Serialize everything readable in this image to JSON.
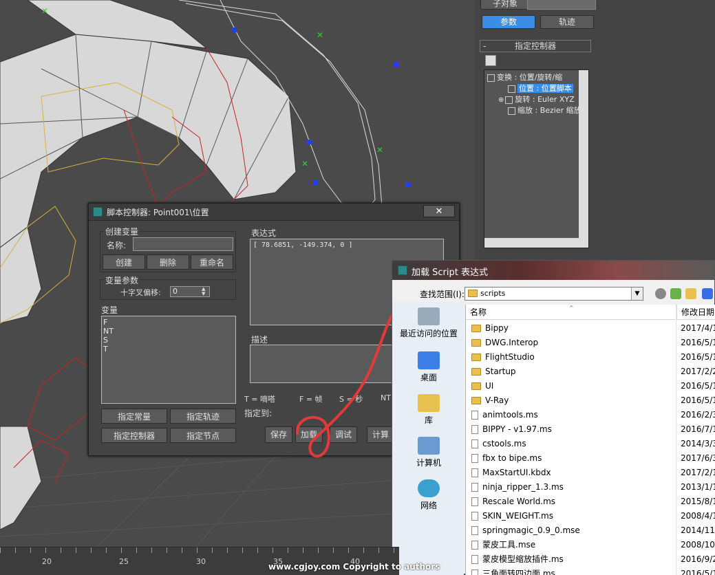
{
  "command_panel": {
    "sub_object_label": "子对象",
    "tabs": [
      {
        "label": "参数",
        "active": true
      },
      {
        "label": "轨迹",
        "active": false
      }
    ],
    "rollout_title": "指定控制器",
    "rollout_toggle": "-",
    "tree": [
      {
        "label": "变换 : 位置/旋转/缩",
        "selected": false
      },
      {
        "label": "位置 : 位置脚本",
        "selected": true
      },
      {
        "label": "旋转 : Euler XYZ",
        "selected": false
      },
      {
        "label": "缩放 : Bezier 缩放",
        "selected": false
      }
    ]
  },
  "script_dialog": {
    "title": "脚本控制器: Point001\\位置",
    "close_label": "✕",
    "create_variable": {
      "group_label": "创建变量",
      "name_label": "名称:",
      "name_value": "",
      "buttons": [
        "创建",
        "删除",
        "重命名"
      ]
    },
    "variable_params": {
      "group_label": "变量参数",
      "offset_label": "十字叉偏移:",
      "offset_value": "0"
    },
    "variables": {
      "label": "变量",
      "items": [
        "F",
        "NT",
        "S",
        "T"
      ]
    },
    "assign_buttons": [
      "指定常量",
      "指定轨迹",
      "指定控制器",
      "指定节点"
    ],
    "expression": {
      "label": "表达式",
      "value": "[ 78.6851, -149.374, 0 ]"
    },
    "description": {
      "label": "描述",
      "value": ""
    },
    "legend": [
      "T = 嘀嗒",
      "F = 帧",
      "S = 秒",
      "NT"
    ],
    "assign_to_label": "指定到:",
    "bottom_buttons": [
      "保存",
      "加载",
      "调试",
      "计算"
    ]
  },
  "file_dialog": {
    "title": "加载 Script 表达式",
    "look_in_label": "查找范围(I):",
    "look_in_value": "scripts",
    "places": [
      "最近访问的位置",
      "桌面",
      "库",
      "计算机",
      "网络"
    ],
    "columns": {
      "name": "名称",
      "date": "修改日期"
    },
    "files": [
      {
        "name": "Bippy",
        "date": "2017/4/1",
        "type": "folder"
      },
      {
        "name": "DWG.Interop",
        "date": "2016/5/1",
        "type": "folder"
      },
      {
        "name": "FlightStudio",
        "date": "2016/5/1",
        "type": "folder"
      },
      {
        "name": "Startup",
        "date": "2017/2/2",
        "type": "folder"
      },
      {
        "name": "UI",
        "date": "2016/5/1",
        "type": "folder"
      },
      {
        "name": "V-Ray",
        "date": "2016/5/1",
        "type": "folder"
      },
      {
        "name": "animtools.ms",
        "date": "2016/2/3",
        "type": "file"
      },
      {
        "name": "BIPPY - v1.97.ms",
        "date": "2016/7/1",
        "type": "file"
      },
      {
        "name": "cstools.ms",
        "date": "2014/3/3",
        "type": "file"
      },
      {
        "name": "fbx to bipe.ms",
        "date": "2017/6/3",
        "type": "file"
      },
      {
        "name": "MaxStartUI.kbdx",
        "date": "2017/2/1",
        "type": "file"
      },
      {
        "name": "ninja_ripper_1.3.ms",
        "date": "2013/1/1",
        "type": "file"
      },
      {
        "name": "Rescale World.ms",
        "date": "2015/8/1",
        "type": "file"
      },
      {
        "name": "SKIN_WEIGHT.ms",
        "date": "2008/4/1",
        "type": "file"
      },
      {
        "name": "springmagic_0.9_0.mse",
        "date": "2014/11/",
        "type": "file"
      },
      {
        "name": "蒙皮工具.mse",
        "date": "2008/10/",
        "type": "file"
      },
      {
        "name": "蒙皮模型缩放插件.ms",
        "date": "2016/9/2",
        "type": "file"
      },
      {
        "name": "三角面转四边面.ms",
        "date": "2016/5/1",
        "type": "file"
      }
    ]
  },
  "timeline": {
    "ticks": [
      "20",
      "25",
      "30",
      "35",
      "40"
    ]
  },
  "watermark": "www.cgjoy.com  Copyright to authors",
  "colors": {
    "accent": "#3a8ee6",
    "annotation": "#e23a3a",
    "wire_yellow": "#d8b23a",
    "wire_red": "#cc2222"
  }
}
